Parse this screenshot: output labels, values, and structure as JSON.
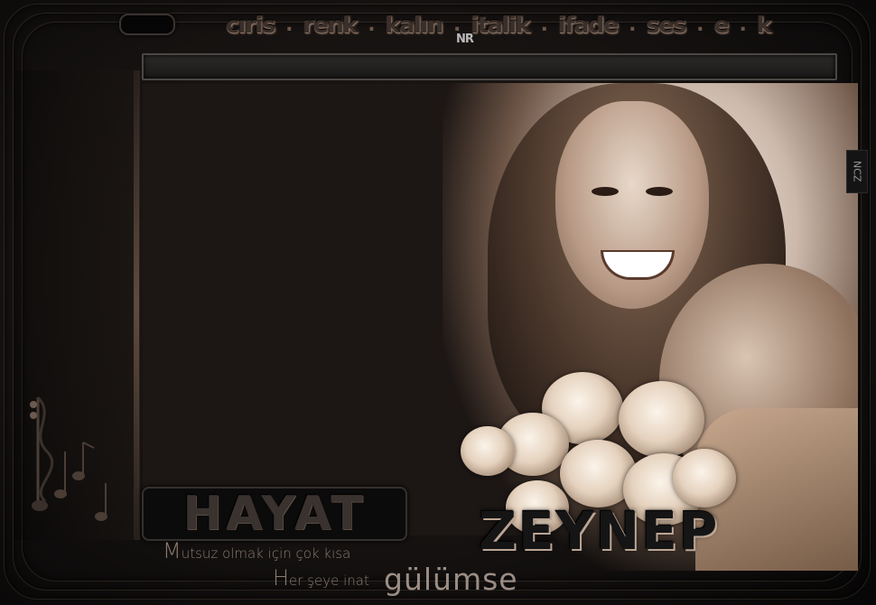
{
  "menu": {
    "items": [
      "cıris",
      "renk",
      "kalın",
      "italik",
      "ifade",
      "ses",
      "e",
      "k"
    ],
    "separator": "."
  },
  "logos": {
    "nr": "NR",
    "side_tag": "NCZ"
  },
  "input": {
    "value": "",
    "placeholder": ""
  },
  "banner": {
    "hayat": "HAYAT",
    "line1_cap": "M",
    "line1_rest": "utsuz olmak için çok kısa",
    "line2_cap": "H",
    "line2_rest": "er şeye inat",
    "gulumse": "gülümse",
    "name": "ZEYNEP"
  },
  "colors": {
    "accent": "#b8967f",
    "background": "#141110"
  }
}
